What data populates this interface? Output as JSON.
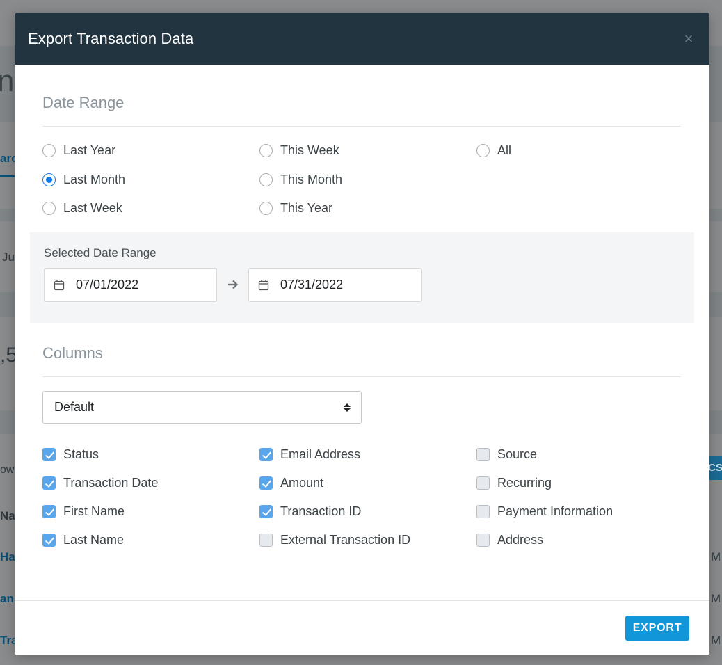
{
  "background": {
    "fragments": {
      "heading": "ng",
      "tab": "arc",
      "month": "Ju",
      "amount": ",5",
      "showing": "ow",
      "col_name": "Na",
      "row1": "Ha",
      "row2": "an",
      "row3": "Tra",
      "time1": "M",
      "time2": "M",
      "time3": "M",
      "csv": "CSV"
    }
  },
  "modal": {
    "title": "Export Transaction Data",
    "close_symbol": "×"
  },
  "date_range": {
    "heading": "Date Range",
    "options": [
      {
        "label": "Last Year",
        "checked": false
      },
      {
        "label": "This Week",
        "checked": false
      },
      {
        "label": "All",
        "checked": false
      },
      {
        "label": "Last Month",
        "checked": true
      },
      {
        "label": "This Month",
        "checked": false
      },
      {
        "label": "Last Week",
        "checked": false
      },
      {
        "label": "This Year",
        "checked": false
      }
    ],
    "selected_label": "Selected Date Range",
    "start_date": "07/01/2022",
    "end_date": "07/31/2022"
  },
  "columns": {
    "heading": "Columns",
    "preset": "Default",
    "items": [
      {
        "label": "Status",
        "checked": true
      },
      {
        "label": "Email Address",
        "checked": true
      },
      {
        "label": "Source",
        "checked": false
      },
      {
        "label": "Transaction Date",
        "checked": true
      },
      {
        "label": "Amount",
        "checked": true
      },
      {
        "label": "Recurring",
        "checked": false
      },
      {
        "label": "First Name",
        "checked": true
      },
      {
        "label": "Transaction ID",
        "checked": true
      },
      {
        "label": "Payment Information",
        "checked": false
      },
      {
        "label": "Last Name",
        "checked": true
      },
      {
        "label": "External Transaction ID",
        "checked": false
      },
      {
        "label": "Address",
        "checked": false
      }
    ]
  },
  "footer": {
    "export_label": "EXPORT"
  },
  "colors": {
    "header_bg": "#22343f",
    "accent": "#1196d9",
    "radio_selected": "#1478e6",
    "checkbox_checked": "#5aa6ed"
  },
  "icons": {
    "calendar": "calendar-icon",
    "arrow": "arrow-right-icon",
    "close": "close-icon",
    "select": "sort-icon"
  }
}
